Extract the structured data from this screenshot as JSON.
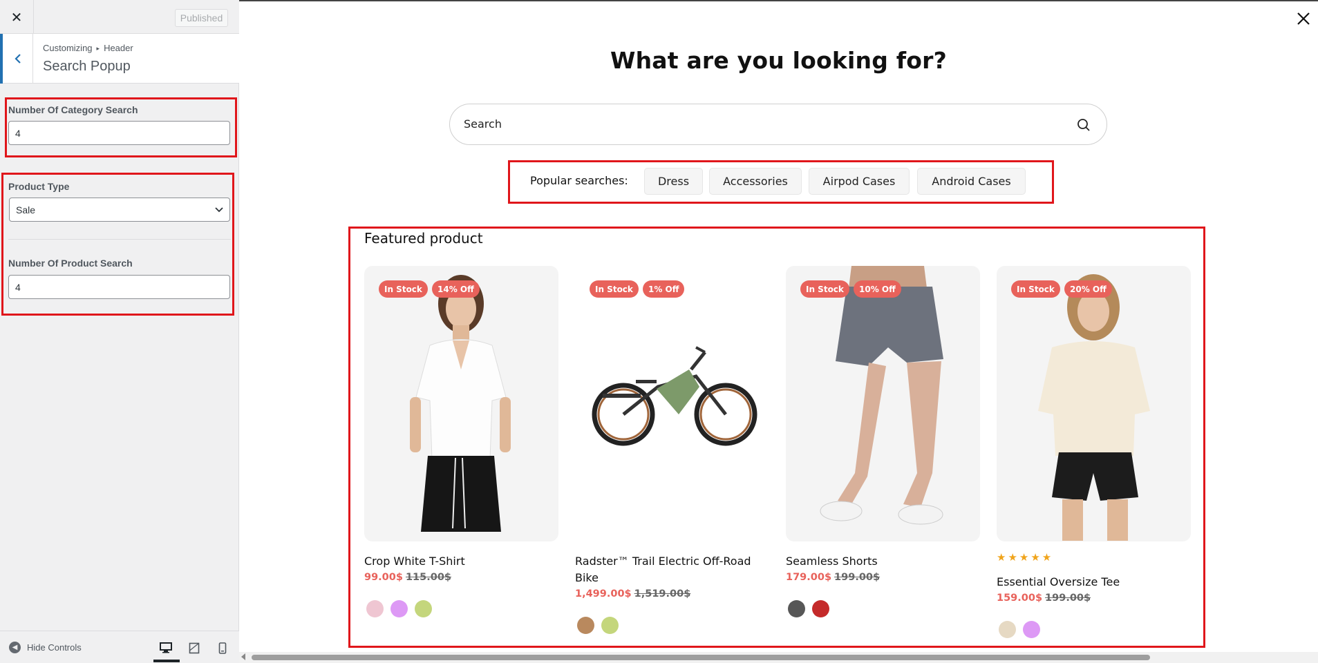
{
  "customizer": {
    "publish_label": "Published",
    "breadcrumb_root": "Customizing",
    "breadcrumb_sep": "▸",
    "breadcrumb_section": "Header",
    "section_title": "Search Popup",
    "category_search_label": "Number Of Category Search",
    "category_search_value": "4",
    "product_type_label": "Product Type",
    "product_type_value": "Sale",
    "product_search_label": "Number Of Product Search",
    "product_search_value": "4",
    "hide_controls_label": "Hide Controls",
    "devices": [
      "desktop-icon",
      "tablet-icon",
      "mobile-icon"
    ],
    "active_device": "desktop"
  },
  "popup": {
    "heading": "What are you looking for?",
    "search_placeholder": "Search",
    "popular_label": "Popular searches:",
    "popular_terms": [
      "Dress",
      "Accessories",
      "Airpod Cases",
      "Android Cases"
    ],
    "featured_title": "Featured product"
  },
  "products": [
    {
      "name": "Crop White T-Shirt",
      "stock_badge": "In Stock",
      "discount_badge": "14% Off",
      "price": "99.00$",
      "old_price": "115.00$",
      "rating": null,
      "swatches": [
        "#efc6d2",
        "#dd99f5",
        "#c4d67c"
      ]
    },
    {
      "name": "Radster™ Trail Electric Off-Road Bike",
      "stock_badge": "In Stock",
      "discount_badge": "1% Off",
      "price": "1,499.00$",
      "old_price": "1,519.00$",
      "rating": null,
      "swatches": [
        "#b9895e",
        "#c4d67c"
      ]
    },
    {
      "name": "Seamless Shorts",
      "stock_badge": "In Stock",
      "discount_badge": "10% Off",
      "price": "179.00$",
      "old_price": "199.00$",
      "rating": null,
      "swatches": [
        "#575757",
        "#c42a2a"
      ]
    },
    {
      "name": "Essential Oversize Tee",
      "stock_badge": "In Stock",
      "discount_badge": "20% Off",
      "price": "159.00$",
      "old_price": "199.00$",
      "rating": 5,
      "swatches": [
        "#e6d9c3",
        "#dd99f5"
      ]
    }
  ],
  "colors": {
    "accent": "#e8625b",
    "highlight": "#e0161b",
    "wp_blue": "#2271b1",
    "star": "#f0a41b"
  }
}
